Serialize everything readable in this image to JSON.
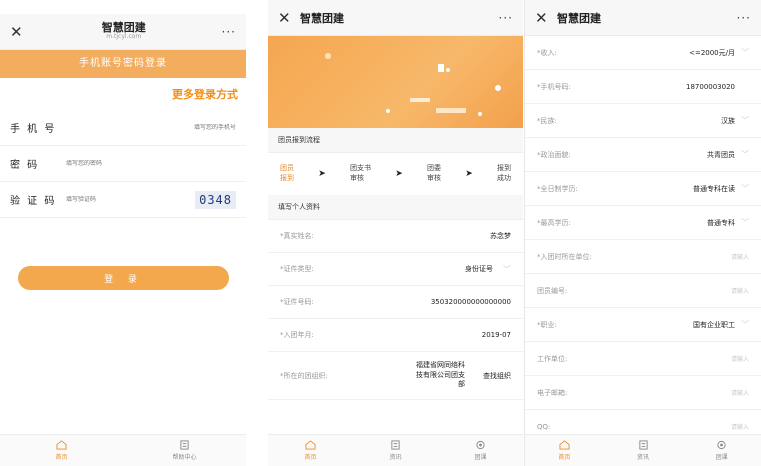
{
  "login": {
    "title": "智慧团建",
    "subtitle": "m.tjcyl.com",
    "close": "✕",
    "more": "···",
    "banner": "手机账号密码登录",
    "more_login": "更多登录方式",
    "phone_label": "手 机 号",
    "phone_placeholder": "填写您的手机号",
    "password_label": "密  码",
    "password_placeholder": "填写您的密码",
    "captcha_label": "验 证 码",
    "captcha_placeholder": "填写验证码",
    "captcha_code": "0348",
    "login_button": "登 录",
    "tabs": [
      {
        "label": "首页",
        "icon": "home-icon"
      },
      {
        "label": "帮助中心",
        "icon": "help-icon"
      }
    ]
  },
  "register": {
    "title": "智慧团建",
    "close": "✕",
    "more": "···",
    "flow_title": "团员报到流程",
    "steps": [
      {
        "line1": "团员",
        "line2": "报到"
      },
      {
        "line1": "团支书",
        "line2": "审核"
      },
      {
        "line1": "团委",
        "line2": "审核"
      },
      {
        "line1": "报到",
        "line2": "成功"
      }
    ],
    "arrow": "➤",
    "info_title": "填写个人资料",
    "fields": {
      "name_label": "*真实姓名:",
      "name_value": "苏念梦",
      "idtype_label": "*证件类型:",
      "idtype_value": "身份证号",
      "idno_label": "*证件号码:",
      "idno_value": "350320000000000000",
      "join_label": "*入团年月:",
      "join_value": "2019-07",
      "org_label": "*所在的团组织:",
      "org_lines": [
        "福建省网同络科",
        "技有限公司团支",
        "部"
      ],
      "org_find": "查找组织"
    },
    "tabs": [
      {
        "label": "首页",
        "icon": "home-icon"
      },
      {
        "label": "资讯",
        "icon": "news-icon"
      },
      {
        "label": "团课",
        "icon": "course-icon"
      }
    ]
  },
  "profile": {
    "title": "智慧团建",
    "close": "✕",
    "more": "···",
    "chevron": "﹀",
    "rows": [
      {
        "label": "*收入:",
        "value": "<=2000元/月",
        "chev": true
      },
      {
        "label": "*手机号码:",
        "value": "18700003020",
        "chev": false
      },
      {
        "label": "*民族:",
        "value": "汉族",
        "chev": true
      },
      {
        "label": "*政治面貌:",
        "value": "共青团员",
        "chev": true
      },
      {
        "label": "*全日制学历:",
        "value": "普通专科在读",
        "chev": true
      },
      {
        "label": "*最高学历:",
        "value": "普通专科",
        "chev": true
      },
      {
        "label": "*入团时所在单位:",
        "placeholder": "请输入"
      },
      {
        "label": "团员编号:",
        "placeholder": "请输入"
      },
      {
        "label": "*职业:",
        "value": "国有企业职工",
        "chev": true
      },
      {
        "label": "工作单位:",
        "placeholder": "请输入"
      },
      {
        "label": "电子邮箱:",
        "placeholder": "请输入"
      },
      {
        "label": "QQ:",
        "placeholder": "请输入"
      }
    ],
    "tabs": [
      {
        "label": "首页",
        "icon": "home-icon"
      },
      {
        "label": "资讯",
        "icon": "news-icon"
      },
      {
        "label": "团课",
        "icon": "course-icon"
      }
    ]
  },
  "colors": {
    "accent": "#f3a84e",
    "active_tab": "#e88c2c",
    "captcha_text": "#233a7a"
  }
}
